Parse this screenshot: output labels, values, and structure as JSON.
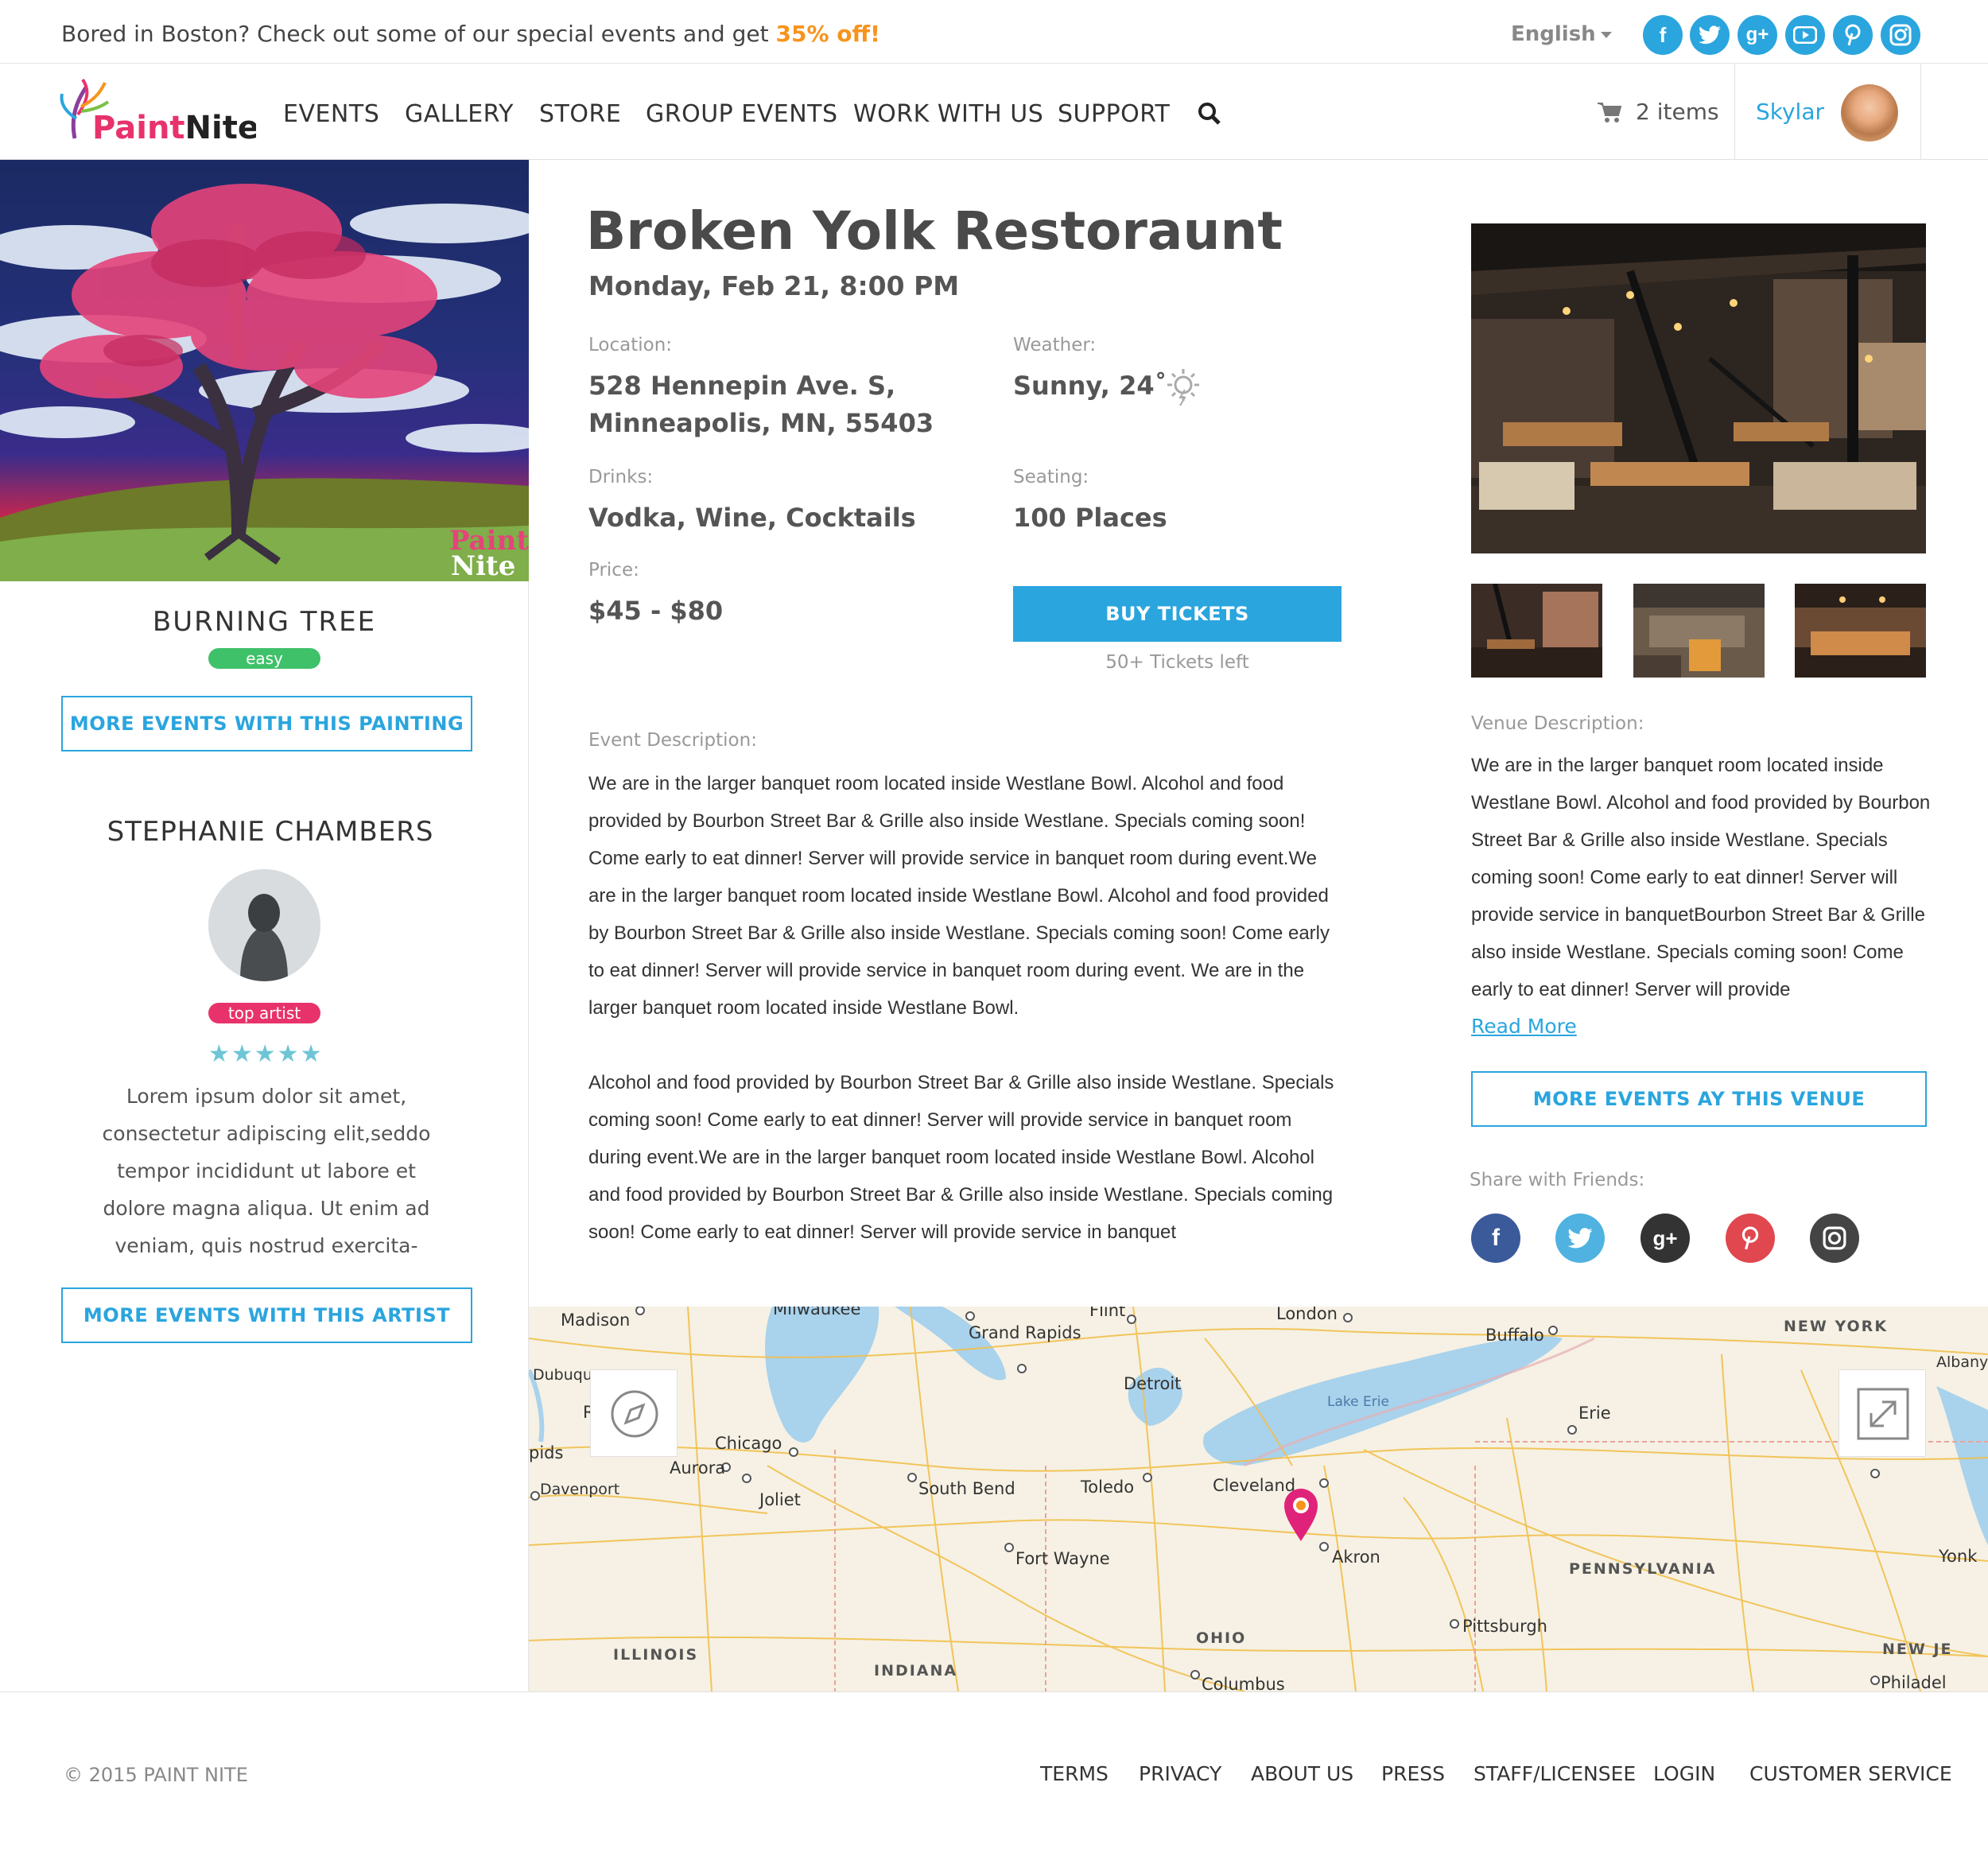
{
  "topbar": {
    "message": "Bored in Boston? Check out some of our special events and get ",
    "discount": "35% off!",
    "language": "English"
  },
  "social_icons": [
    "facebook-icon",
    "twitter-icon",
    "google-plus-icon",
    "youtube-icon",
    "pinterest-icon",
    "instagram-icon"
  ],
  "brand": {
    "logo_text_a": "Paint",
    "logo_text_b": "Nite",
    "accent": "#2aa5de",
    "orange": "#f7941d"
  },
  "nav": {
    "items": [
      "EVENTS",
      "GALLERY",
      "STORE",
      "GROUP EVENTS",
      "WORK WITH US",
      "SUPPORT"
    ],
    "cart": "2 items",
    "user": "Skylar"
  },
  "painting": {
    "title": "BURNING TREE",
    "difficulty": "easy",
    "watermark_a": "Paint",
    "watermark_b": "Nite",
    "more_button": "MORE EVENTS WITH THIS PAINTING"
  },
  "artist": {
    "name": "STEPHANIE CHAMBERS",
    "badge": "top artist",
    "rating": 4.5,
    "stars": "★★★★★",
    "bio": "Lorem ipsum dolor sit amet, consectetur adipiscing elit,seddo tempor incididunt ut labore et dolore magna aliqua. Ut enim ad veniam, quis nostrud exercita-",
    "more_button": "MORE EVENTS WITH THIS ARTIST"
  },
  "event": {
    "title": "Broken Yolk Restoraunt",
    "date": "Monday, Feb 21, 8:00 PM",
    "location_label": "Location:",
    "location_line1": "528 Hennepin Ave. S,",
    "location_line2": "Minneapolis, MN, 55403",
    "weather_label": "Weather:",
    "weather": "Sunny, 24˚",
    "drinks_label": "Drinks:",
    "drinks": "Vodka, Wine, Cocktails",
    "seating_label": "Seating:",
    "seating": "100 Places",
    "price_label": "Price:",
    "price": "$45 - $80",
    "buy_button": "BUY TICKETS",
    "tickets_left": "50+ Tickets left",
    "description_label": "Event Description:",
    "description_p1": "We are in the larger banquet room located inside Westlane Bowl.  Alcohol and food provided by Bourbon Street Bar & Grille also inside Westlane.  Specials coming soon! Come early to eat dinner! Server will provide service in banquet room during event.We are in the larger banquet room located inside Westlane Bowl.  Alcohol and food provided by Bourbon Street Bar & Grille also inside Westlane.  Specials coming soon! Come early to eat dinner! Server will provide service in banquet room during event. We are in the larger banquet room located inside Westlane Bowl.",
    "description_p2": " Alcohol and food provided by Bourbon Street Bar & Grille also inside Westlane. Specials coming soon! Come early to eat dinner! Server will provide service in banquet room during event.We are in the larger banquet room located inside Westlane Bowl. Alcohol and food provided by Bourbon Street Bar & Grille also inside Westlane. Specials coming soon! Come early to eat dinner! Server will provide service in banquet"
  },
  "venue": {
    "description_label": "Venue Description:",
    "description": "We are in the larger banquet room located inside Westlane Bowl.  Alcohol and food provided by Bourbon Street Bar & Grille also inside Westlane. Specials coming soon! Come early to eat dinner! Server will provide service in banquetBourbon Street Bar & Grille also inside Westlane.  Specials coming soon! Come early to eat dinner! Server will provide",
    "read_more": "Read More",
    "more_button": "MORE EVENTS AY THIS VENUE",
    "share_label": "Share with Friends:"
  },
  "share_icons": [
    "facebook-icon",
    "twitter-icon",
    "google-plus-icon",
    "pinterest-icon",
    "instagram-icon"
  ],
  "map": {
    "cities": [
      "Madison",
      "Milwaukee",
      "Flint",
      "London",
      "Grand Rapids",
      "Buffalo",
      "NEW YORK",
      "Albany",
      "Dubuque",
      "Detroit",
      "Lake Erie",
      "Erie",
      "Chicago",
      "Aurora",
      "Davenport",
      "Joliet",
      "South Bend",
      "Toledo",
      "Cleveland",
      "Fort Wayne",
      "Akron",
      "PENNSYLVANIA",
      "Pittsburgh",
      "ILLINOIS",
      "INDIANA",
      "OHIO",
      "Columbus",
      "NEW JE",
      "Philadel",
      "Yonk",
      "pids",
      "R"
    ]
  },
  "footer": {
    "copyright": "© 2015 PAINT NITE",
    "links": [
      "TERMS",
      "PRIVACY",
      "ABOUT US",
      "PRESS",
      "STAFF/LICENSEE",
      "LOGIN",
      "CUSTOMER SERVICE"
    ]
  }
}
